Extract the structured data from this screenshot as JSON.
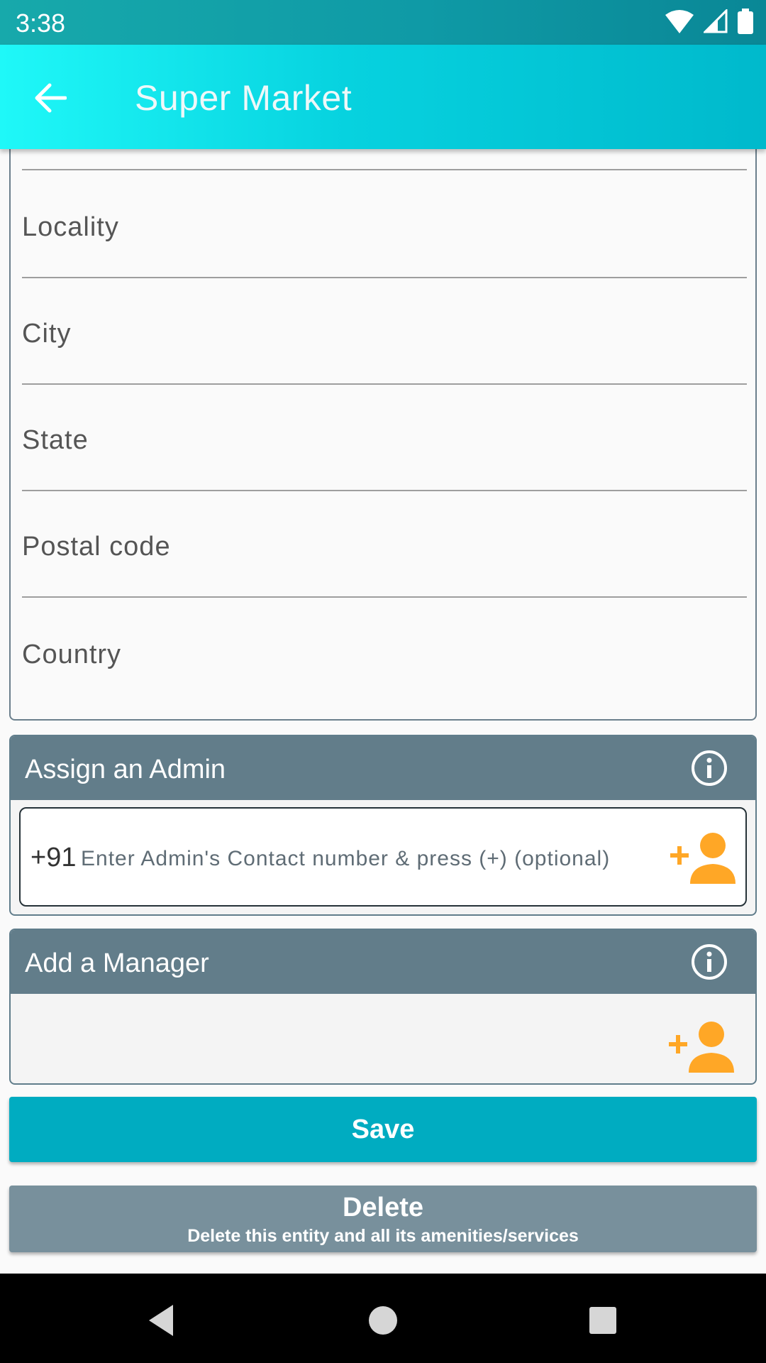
{
  "status_bar": {
    "time": "3:38"
  },
  "app_bar": {
    "title": "Super Market"
  },
  "address_fields": [
    {
      "label": ""
    },
    {
      "label": "Locality"
    },
    {
      "label": "City"
    },
    {
      "label": "State"
    },
    {
      "label": "Postal code"
    },
    {
      "label": "Country"
    }
  ],
  "admin_section": {
    "title": "Assign an Admin",
    "prefix": "+91",
    "placeholder": "Enter Admin's Contact number & press (+) (optional)"
  },
  "manager_section": {
    "title": "Add a Manager"
  },
  "buttons": {
    "save": "Save",
    "delete": "Delete",
    "delete_sub": "Delete this entity and all its amenities/services"
  },
  "colors": {
    "accent": "#00acc1",
    "section_header": "#627d8a",
    "add_icon": "#ffa726",
    "delete": "#78909c"
  }
}
